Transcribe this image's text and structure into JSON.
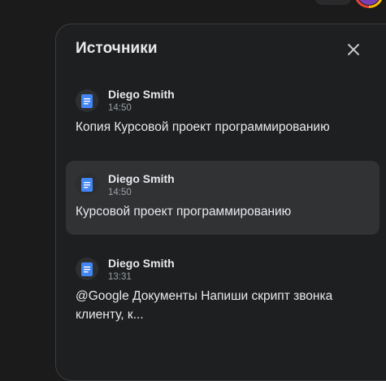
{
  "panel": {
    "title": "Источники",
    "close_icon": "close-icon"
  },
  "sources": [
    {
      "author": "Diego Smith",
      "time": "14:50",
      "title": "Копия Курсовой проект программированию",
      "icon": "google-docs-icon",
      "active": false
    },
    {
      "author": "Diego Smith",
      "time": "14:50",
      "title": "Курсовой проект программированию",
      "icon": "google-docs-icon",
      "active": true
    },
    {
      "author": "Diego Smith",
      "time": "13:31",
      "title": "@Google Документы Напиши скрипт звонка клиенту, к...",
      "icon": "google-docs-icon",
      "active": false
    }
  ],
  "colors": {
    "background": "#1b1b1c",
    "panel": "#1e1f20",
    "active_item": "#313234",
    "docs_blue": "#4285f4",
    "avatar": "#7b3fb5"
  }
}
